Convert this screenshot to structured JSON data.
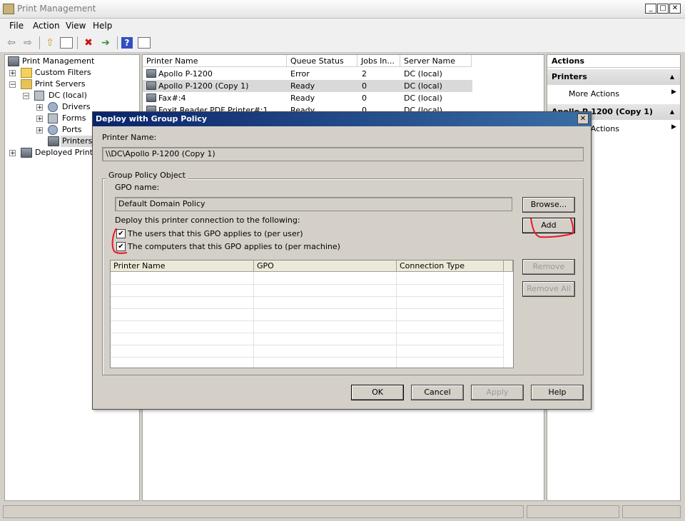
{
  "window": {
    "title": "Print Management"
  },
  "menu": [
    "File",
    "Action",
    "View",
    "Help"
  ],
  "tree": {
    "root": "Print Management",
    "custom_filters": "Custom Filters",
    "print_servers": "Print Servers",
    "dc": "DC (local)",
    "drivers": "Drivers",
    "forms": "Forms",
    "ports": "Ports",
    "printers": "Printers",
    "deployed": "Deployed Printer"
  },
  "list": {
    "columns": [
      "Printer Name",
      "Queue Status",
      "Jobs In...",
      "Server Name"
    ],
    "rows": [
      {
        "name": "Apollo P-1200",
        "status": "Error",
        "jobs": "2",
        "server": "DC (local)"
      },
      {
        "name": "Apollo P-1200 (Copy 1)",
        "status": "Ready",
        "jobs": "0",
        "server": "DC (local)"
      },
      {
        "name": "Fax#:4",
        "status": "Ready",
        "jobs": "0",
        "server": "DC (local)"
      },
      {
        "name": "Foxit Reader PDF Printer#:1",
        "status": "Ready",
        "jobs": "0",
        "server": "DC (local)"
      }
    ]
  },
  "actions": {
    "title": "Actions",
    "section1": "Printers",
    "more1": "More Actions",
    "section2": "Apollo P-1200 (Copy 1)",
    "more2": "More Actions"
  },
  "dialog": {
    "title": "Deploy with Group Policy",
    "printer_name_label": "Printer Name:",
    "printer_name_value": "\\\\DC\\Apollo P-1200 (Copy 1)",
    "group_label": "Group Policy Object",
    "gpo_name_label": "GPO name:",
    "gpo_name_value": "Default Domain Policy",
    "browse": "Browse...",
    "deploy_label": "Deploy this printer connection to the following:",
    "per_user": "The users that this GPO applies to (per user)",
    "per_machine": "The computers that this GPO applies to (per machine)",
    "add": "Add",
    "remove": "Remove",
    "remove_all": "Remove All",
    "grid_columns": [
      "Printer Name",
      "GPO",
      "Connection Type"
    ],
    "ok": "OK",
    "cancel": "Cancel",
    "apply": "Apply",
    "help": "Help"
  },
  "colors": {
    "dialog_title_start": "#0a246a",
    "dialog_title_end": "#3a6ea5",
    "annotation": "#e8192c"
  }
}
